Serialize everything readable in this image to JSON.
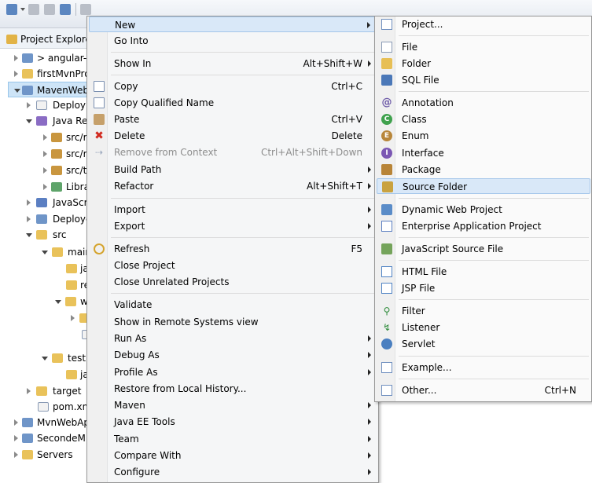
{
  "explorer": {
    "title": "Project Explore",
    "items": [
      {
        "label": "> angular-"
      },
      {
        "label": "firstMvnPro"
      },
      {
        "label": "MavenWeb"
      },
      {
        "label": "Deployr"
      },
      {
        "label": "Java Re"
      },
      {
        "label": "src/r"
      },
      {
        "label": "src/r"
      },
      {
        "label": "src/t"
      },
      {
        "label": "Libra"
      },
      {
        "label": "JavaScri"
      },
      {
        "label": "Deploye"
      },
      {
        "label": "src"
      },
      {
        "label": "mair"
      },
      {
        "label": "ja"
      },
      {
        "label": "re"
      },
      {
        "label": "w"
      },
      {
        "label": ""
      },
      {
        "label": ""
      },
      {
        "label": "test"
      },
      {
        "label": "ja"
      },
      {
        "label": "target"
      },
      {
        "label": "pom.xm"
      },
      {
        "label": "MvnWebAp"
      },
      {
        "label": "SecondeM"
      },
      {
        "label": "Servers"
      }
    ]
  },
  "context_menu": {
    "items": [
      {
        "label": "New",
        "shortcut": "",
        "submenu": true,
        "highlighted": true,
        "icon": "none"
      },
      {
        "label": "Go Into",
        "shortcut": "",
        "icon": "none"
      },
      {
        "label": "Show In",
        "shortcut": "Alt+Shift+W",
        "submenu": true,
        "icon": "none"
      },
      {
        "label": "Copy",
        "shortcut": "Ctrl+C",
        "icon": "copy-icon"
      },
      {
        "label": "Copy Qualified Name",
        "shortcut": "",
        "icon": "copy-qualified-icon"
      },
      {
        "label": "Paste",
        "shortcut": "Ctrl+V",
        "icon": "paste-icon"
      },
      {
        "label": "Delete",
        "shortcut": "Delete",
        "icon": "delete-icon"
      },
      {
        "label": "Remove from Context",
        "shortcut": "Ctrl+Alt+Shift+Down",
        "disabled": true,
        "icon": "remove-context-icon"
      },
      {
        "label": "Build Path",
        "shortcut": "",
        "submenu": true,
        "icon": "none"
      },
      {
        "label": "Refactor",
        "shortcut": "Alt+Shift+T",
        "submenu": true,
        "icon": "none"
      },
      {
        "label": "Import",
        "shortcut": "",
        "submenu": true,
        "icon": "none"
      },
      {
        "label": "Export",
        "shortcut": "",
        "submenu": true,
        "icon": "none"
      },
      {
        "label": "Refresh",
        "shortcut": "F5",
        "icon": "refresh-icon"
      },
      {
        "label": "Close Project",
        "shortcut": "",
        "icon": "none"
      },
      {
        "label": "Close Unrelated Projects",
        "shortcut": "",
        "icon": "none"
      },
      {
        "label": "Validate",
        "shortcut": "",
        "icon": "none"
      },
      {
        "label": "Show in Remote Systems view",
        "shortcut": "",
        "icon": "none"
      },
      {
        "label": "Run As",
        "shortcut": "",
        "submenu": true,
        "icon": "none"
      },
      {
        "label": "Debug As",
        "shortcut": "",
        "submenu": true,
        "icon": "none"
      },
      {
        "label": "Profile As",
        "shortcut": "",
        "submenu": true,
        "icon": "none"
      },
      {
        "label": "Restore from Local History...",
        "shortcut": "",
        "icon": "none"
      },
      {
        "label": "Maven",
        "shortcut": "",
        "submenu": true,
        "icon": "none"
      },
      {
        "label": "Java EE Tools",
        "shortcut": "",
        "submenu": true,
        "icon": "none"
      },
      {
        "label": "Team",
        "shortcut": "",
        "submenu": true,
        "icon": "none"
      },
      {
        "label": "Compare With",
        "shortcut": "",
        "submenu": true,
        "icon": "none"
      },
      {
        "label": "Configure",
        "shortcut": "",
        "submenu": true,
        "icon": "none"
      }
    ]
  },
  "new_submenu": {
    "items": [
      {
        "label": "Project...",
        "shortcut": "",
        "icon": "new-project-icon"
      },
      {
        "label": "File",
        "shortcut": "",
        "icon": "file-icon"
      },
      {
        "label": "Folder",
        "shortcut": "",
        "icon": "folder-icon"
      },
      {
        "label": "SQL File",
        "shortcut": "",
        "icon": "sql-file-icon"
      },
      {
        "label": "Annotation",
        "shortcut": "",
        "icon": "annotation-icon"
      },
      {
        "label": "Class",
        "shortcut": "",
        "icon": "class-icon"
      },
      {
        "label": "Enum",
        "shortcut": "",
        "icon": "enum-icon"
      },
      {
        "label": "Interface",
        "shortcut": "",
        "icon": "interface-icon"
      },
      {
        "label": "Package",
        "shortcut": "",
        "icon": "package-icon"
      },
      {
        "label": "Source Folder",
        "shortcut": "",
        "highlighted": true,
        "icon": "source-folder-icon"
      },
      {
        "label": "Dynamic Web Project",
        "shortcut": "",
        "icon": "web-project-icon"
      },
      {
        "label": "Enterprise Application Project",
        "shortcut": "",
        "icon": "ear-project-icon"
      },
      {
        "label": "JavaScript Source File",
        "shortcut": "",
        "icon": "js-file-icon"
      },
      {
        "label": "HTML File",
        "shortcut": "",
        "icon": "html-file-icon"
      },
      {
        "label": "JSP File",
        "shortcut": "",
        "icon": "jsp-file-icon"
      },
      {
        "label": "Filter",
        "shortcut": "",
        "icon": "filter-icon"
      },
      {
        "label": "Listener",
        "shortcut": "",
        "icon": "listener-icon"
      },
      {
        "label": "Servlet",
        "shortcut": "",
        "icon": "servlet-icon"
      },
      {
        "label": "Example...",
        "shortcut": "",
        "icon": "example-icon"
      },
      {
        "label": "Other...",
        "shortcut": "Ctrl+N",
        "icon": "other-icon"
      }
    ]
  }
}
